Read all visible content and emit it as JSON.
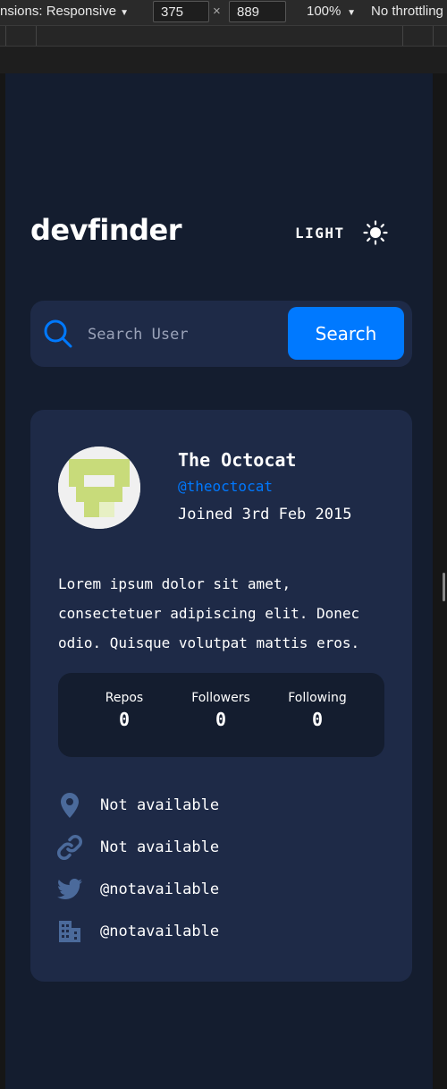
{
  "devtools": {
    "dimensions_label": "nsions: Responsive",
    "width_value": "375",
    "height_value": "889",
    "times": "×",
    "zoom": "100%",
    "throttle": "No throttling"
  },
  "app": {
    "logo": "devfinder",
    "theme_label": "LIGHT",
    "theme_icon": "sun-icon",
    "search": {
      "placeholder": "Search User",
      "value": "",
      "button_label": "Search"
    },
    "profile": {
      "name": "The Octocat",
      "handle": "@theoctocat",
      "joined": "Joined 3rd Feb 2015",
      "bio": "Lorem ipsum dolor sit amet, consectetuer adipiscing elit. Donec odio. Quisque volutpat mattis eros.",
      "stats": [
        {
          "label": "Repos",
          "value": "0"
        },
        {
          "label": "Followers",
          "value": "0"
        },
        {
          "label": "Following",
          "value": "0"
        }
      ],
      "links": [
        {
          "icon": "location-icon",
          "text": "Not available"
        },
        {
          "icon": "link-icon",
          "text": "Not available"
        },
        {
          "icon": "twitter-icon",
          "text": "@notavailable"
        },
        {
          "icon": "company-icon",
          "text": "@notavailable"
        }
      ]
    }
  },
  "colors": {
    "background": "#141d2f",
    "card": "#1e2a47",
    "accent": "#0079ff",
    "avatar_green": "#c8db7a",
    "icon_muted": "#4b6a9b"
  }
}
